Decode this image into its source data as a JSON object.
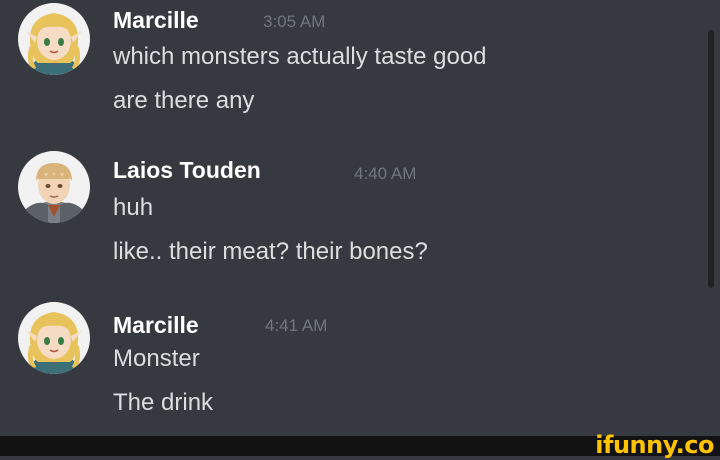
{
  "messages": [
    {
      "author": "Marcille",
      "time": "3:05 AM",
      "avatar": "elf-girl-avatar",
      "lines": [
        "which monsters actually taste good",
        "are there any"
      ]
    },
    {
      "author": "Laios Touden",
      "time": "4:40 AM",
      "avatar": "armored-man-avatar",
      "lines": [
        "huh",
        "like.. their meat? their bones?"
      ]
    },
    {
      "author": "Marcille",
      "time": "4:41 AM",
      "avatar": "elf-girl-avatar",
      "lines": [
        "Monster",
        "The drink"
      ]
    }
  ],
  "watermark": "ifunny.co",
  "colors": {
    "background": "#36393f",
    "author": "#ffffff",
    "text": "#dcddde",
    "timestamp": "#72767d",
    "watermark": "#ffc300"
  }
}
